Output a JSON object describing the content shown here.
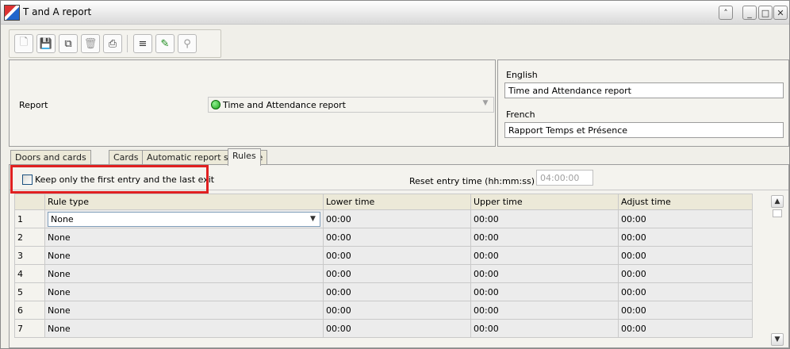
{
  "window": {
    "title": "T and A report"
  },
  "toolbar": {
    "buttons": [
      {
        "name": "new-icon",
        "glyph": "🗋"
      },
      {
        "name": "save-icon",
        "glyph": "💾"
      },
      {
        "name": "copy-icon",
        "glyph": "⧉"
      },
      {
        "name": "delete-icon",
        "glyph": "🗑"
      },
      {
        "name": "print-icon",
        "glyph": "⎙"
      },
      {
        "name": "list-icon",
        "glyph": "≡"
      },
      {
        "name": "link-icon",
        "glyph": "✎"
      },
      {
        "name": "find-icon",
        "glyph": "🔍"
      }
    ]
  },
  "report": {
    "label": "Report",
    "selected": "Time and Attendance report"
  },
  "lang": {
    "english_label": "English",
    "english_value": "Time and Attendance report",
    "french_label": "French",
    "french_value": "Rapport Temps et Présence"
  },
  "tabs": [
    "Doors and cards",
    "Cards",
    "Automatic report schedule",
    "Rules"
  ],
  "options": {
    "keep_first_last": "Keep only the first entry and the last exit",
    "reset_label": "Reset entry time (hh:mm:ss)",
    "reset_value": "04:00:00"
  },
  "grid": {
    "headers": [
      "",
      "Rule type",
      "Lower time",
      "Upper time",
      "Adjust time"
    ],
    "rows": [
      {
        "n": "1",
        "rule": "None",
        "lower": "00:00",
        "upper": "00:00",
        "adjust": "00:00"
      },
      {
        "n": "2",
        "rule": "None",
        "lower": "00:00",
        "upper": "00:00",
        "adjust": "00:00"
      },
      {
        "n": "3",
        "rule": "None",
        "lower": "00:00",
        "upper": "00:00",
        "adjust": "00:00"
      },
      {
        "n": "4",
        "rule": "None",
        "lower": "00:00",
        "upper": "00:00",
        "adjust": "00:00"
      },
      {
        "n": "5",
        "rule": "None",
        "lower": "00:00",
        "upper": "00:00",
        "adjust": "00:00"
      },
      {
        "n": "6",
        "rule": "None",
        "lower": "00:00",
        "upper": "00:00",
        "adjust": "00:00"
      },
      {
        "n": "7",
        "rule": "None",
        "lower": "00:00",
        "upper": "00:00",
        "adjust": "00:00"
      }
    ]
  },
  "colors": {
    "highlight": "#e02020",
    "status_dot": "#1aa21a"
  }
}
